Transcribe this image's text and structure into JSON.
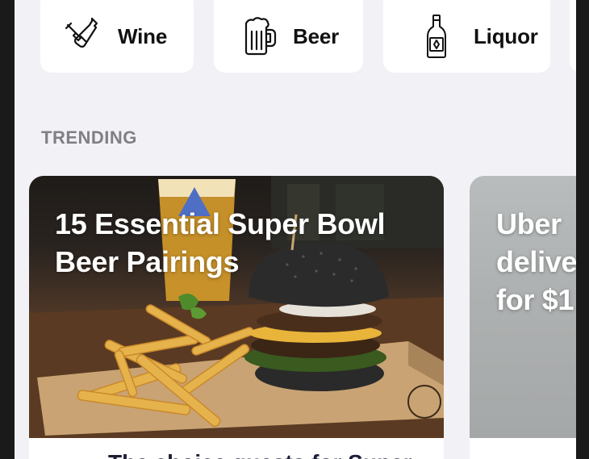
{
  "categories": [
    {
      "label": "Wine",
      "icon": "wine-bottle-icon"
    },
    {
      "label": "Beer",
      "icon": "beer-mug-icon"
    },
    {
      "label": "Liquor",
      "icon": "liquor-bottle-icon"
    }
  ],
  "trending": {
    "section_title": "TRENDING",
    "cards": [
      {
        "title": "15 Essential Super Bowl Beer Pairings",
        "subtitle": "The choice guests for Super"
      },
      {
        "title": "Uber\ndelive\nfor $1"
      }
    ]
  },
  "colors": {
    "background": "#f2f2f6",
    "tile": "#ffffff",
    "section_title": "#808084",
    "card_title": "#ffffff"
  }
}
